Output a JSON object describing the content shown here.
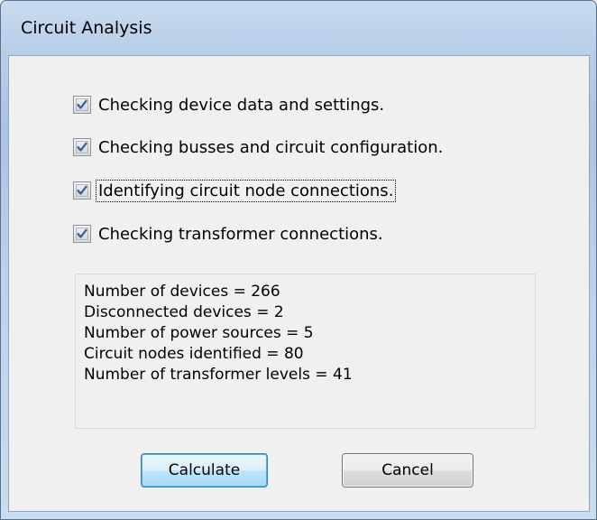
{
  "window": {
    "title": "Circuit Analysis"
  },
  "checks": [
    {
      "label": "Checking device data and settings.",
      "checked": true
    },
    {
      "label": "Checking busses and circuit configuration.",
      "checked": true
    },
    {
      "label": "Identifying circuit node connections.",
      "checked": true
    },
    {
      "label": "Checking transformer connections.",
      "checked": true
    }
  ],
  "results": [
    "Number of devices = 266",
    "Disconnected devices = 2",
    "Number of power sources = 5",
    "Circuit nodes identified = 80",
    "Number of transformer levels = 41"
  ],
  "buttons": {
    "calculate": "Calculate",
    "cancel": "Cancel"
  },
  "colors": {
    "titlebar": "#bcd1ea",
    "check_mark": "#3e5b8a",
    "default_button_border": "#3c7fb1"
  }
}
